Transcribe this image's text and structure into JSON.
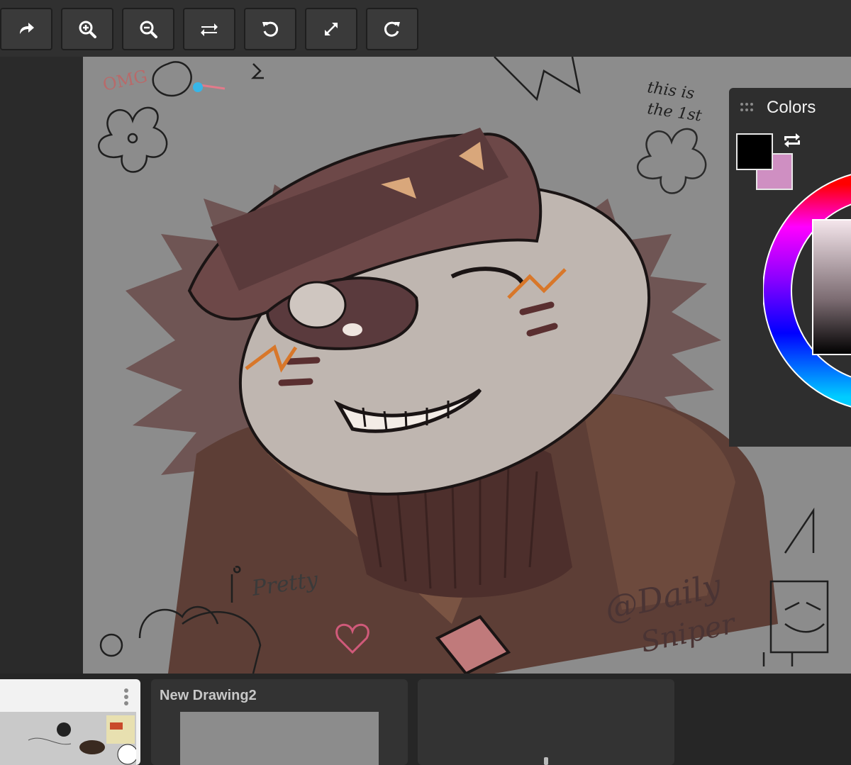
{
  "toolbar": {
    "buttons": [
      {
        "name": "redo-arrow",
        "icon": "share-arrow-icon"
      },
      {
        "name": "zoom-in",
        "icon": "zoom-in-icon"
      },
      {
        "name": "zoom-out",
        "icon": "zoom-out-icon"
      },
      {
        "name": "flip",
        "icon": "flip-arrows-icon"
      },
      {
        "name": "rotate-left",
        "icon": "rotate-ccw-icon"
      },
      {
        "name": "fit-screen",
        "icon": "expand-icon"
      },
      {
        "name": "rotate-right",
        "icon": "rotate-cw-icon"
      }
    ]
  },
  "canvas": {
    "doodle_texts": {
      "omg": "OMG",
      "this_is": "this is",
      "the_1st": "the 1st",
      "pretty": "Pretty",
      "signature_line1": "@Daily",
      "signature_line2": "Sniper"
    }
  },
  "colors_panel": {
    "title": "Colors",
    "primary_color": "#000000",
    "secondary_color": "#cf8fc2"
  },
  "gallery": {
    "cards": [
      {
        "title": ""
      },
      {
        "title": "New Drawing2"
      },
      {
        "title": ""
      }
    ]
  }
}
